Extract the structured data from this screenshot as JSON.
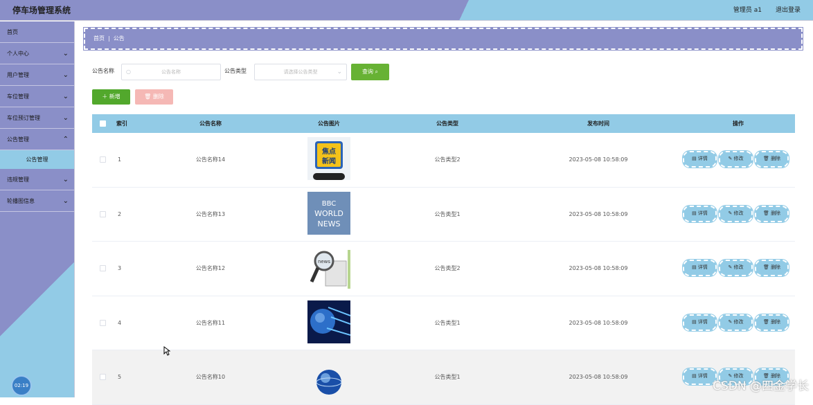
{
  "header": {
    "title": "停车场管理系统",
    "admin": "管理员 a1",
    "logout": "退出登录"
  },
  "sidebar": {
    "items": [
      {
        "label": "首页",
        "chevron": ""
      },
      {
        "label": "个人中心",
        "chevron": "⌄"
      },
      {
        "label": "用户管理",
        "chevron": "⌄"
      },
      {
        "label": "车位管理",
        "chevron": "⌄"
      },
      {
        "label": "车位预订管理",
        "chevron": "⌄"
      },
      {
        "label": "公告管理",
        "chevron": "⌃"
      },
      {
        "label": "违规管理",
        "chevron": "⌄"
      },
      {
        "label": "轮播图信息",
        "chevron": "⌄"
      }
    ],
    "active_sub": "公告管理",
    "clock": "02:19"
  },
  "breadcrumb": {
    "home": "首页",
    "current": "公告"
  },
  "search": {
    "name_label": "公告名称",
    "name_placeholder": "公告名称",
    "type_label": "公告类型",
    "type_placeholder": "请选择公告类型",
    "query_button": "查询"
  },
  "actions": {
    "add": "新增",
    "delete": "删除"
  },
  "table": {
    "columns": [
      "索引",
      "公告名称",
      "公告图片",
      "公告类型",
      "发布时间",
      "操作"
    ],
    "rows": [
      {
        "index": "1",
        "name": "公告名称14",
        "type": "公告类型2",
        "time": "2023-05-08 10:58:09",
        "image": "news-badge"
      },
      {
        "index": "2",
        "name": "公告名称13",
        "type": "公告类型1",
        "time": "2023-05-08 10:58:09",
        "image": "bbc-world-news"
      },
      {
        "index": "3",
        "name": "公告名称12",
        "type": "公告类型2",
        "time": "2023-05-08 10:58:09",
        "image": "magnifier-news"
      },
      {
        "index": "4",
        "name": "公告名称11",
        "type": "公告类型1",
        "time": "2023-05-08 10:58:09",
        "image": "globe-tech"
      },
      {
        "index": "5",
        "name": "公告名称10",
        "type": "公告类型1",
        "time": "2023-05-08 10:58:09",
        "image": "globe-www"
      }
    ],
    "op_labels": {
      "detail": "详情",
      "edit": "修改",
      "delete": "删除"
    }
  },
  "thumb_text": {
    "row1_line1": "焦点",
    "row1_line2": "新闻",
    "row2_line1": "BBC",
    "row2_line2": "WORLD",
    "row2_line3": "NEWS",
    "row3": "news"
  },
  "watermark": "CSDN @四金学长",
  "colors": {
    "primary": "#8a8fc8",
    "accent": "#92cbe6",
    "success": "#67b234",
    "danger_light": "#f5b8b5"
  }
}
